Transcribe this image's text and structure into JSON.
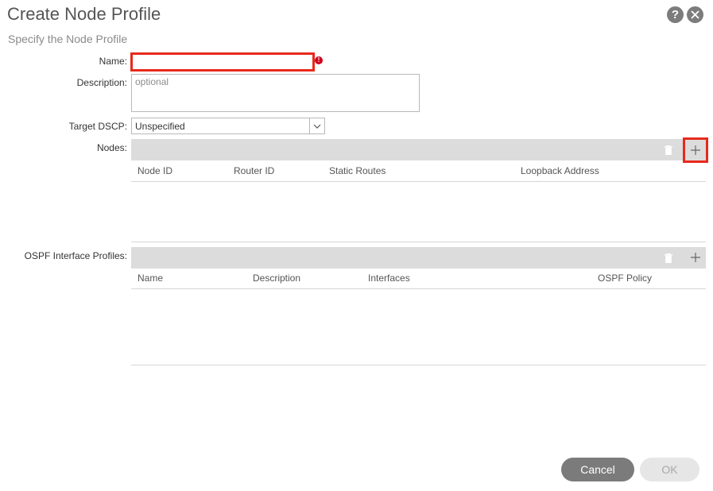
{
  "header": {
    "title": "Create Node Profile",
    "subtitle": "Specify the Node Profile",
    "help_icon": "?"
  },
  "form": {
    "name_label": "Name:",
    "name_value": "",
    "error_icon": "!",
    "description_label": "Description:",
    "description_placeholder": "optional",
    "target_dscp_label": "Target DSCP:",
    "target_dscp_value": "Unspecified"
  },
  "nodes": {
    "label": "Nodes:",
    "columns": [
      "Node ID",
      "Router ID",
      "Static Routes",
      "Loopback Address"
    ],
    "rows": []
  },
  "ospf": {
    "label": "OSPF Interface Profiles:",
    "columns": [
      "Name",
      "Description",
      "Interfaces",
      "OSPF Policy"
    ],
    "rows": []
  },
  "footer": {
    "cancel_label": "Cancel",
    "ok_label": "OK"
  },
  "colors": {
    "highlight": "#e8291c",
    "toolbar": "#dcdcdc",
    "cancel_button": "#7b7b7b",
    "ok_button_disabled": "#e6e6e6"
  }
}
